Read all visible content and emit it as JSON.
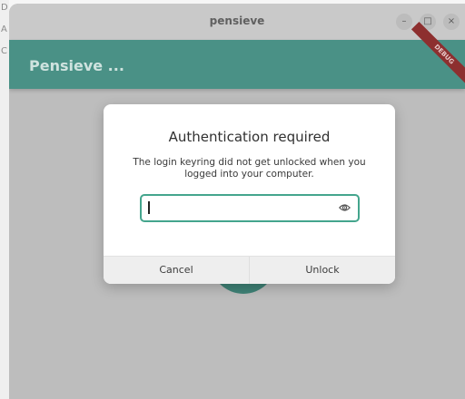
{
  "desktop": {
    "glyphs": [
      "D",
      "A",
      "C"
    ]
  },
  "window": {
    "title": "pensieve",
    "controls": {
      "minimize": "–",
      "maximize": "□",
      "close": "×"
    }
  },
  "appbar": {
    "title": "Pensieve ...",
    "debug_banner": "DEBUG"
  },
  "dialog": {
    "title": "Authentication required",
    "message": "The login keyring did not get unlocked when you logged into your computer.",
    "password_value": "",
    "reveal_icon": "eye-icon",
    "cancel_label": "Cancel",
    "unlock_label": "Unlock"
  },
  "colors": {
    "accent": "#4a9186",
    "focus_ring": "#44a58d",
    "debug_ribbon": "#8d2f2f"
  }
}
